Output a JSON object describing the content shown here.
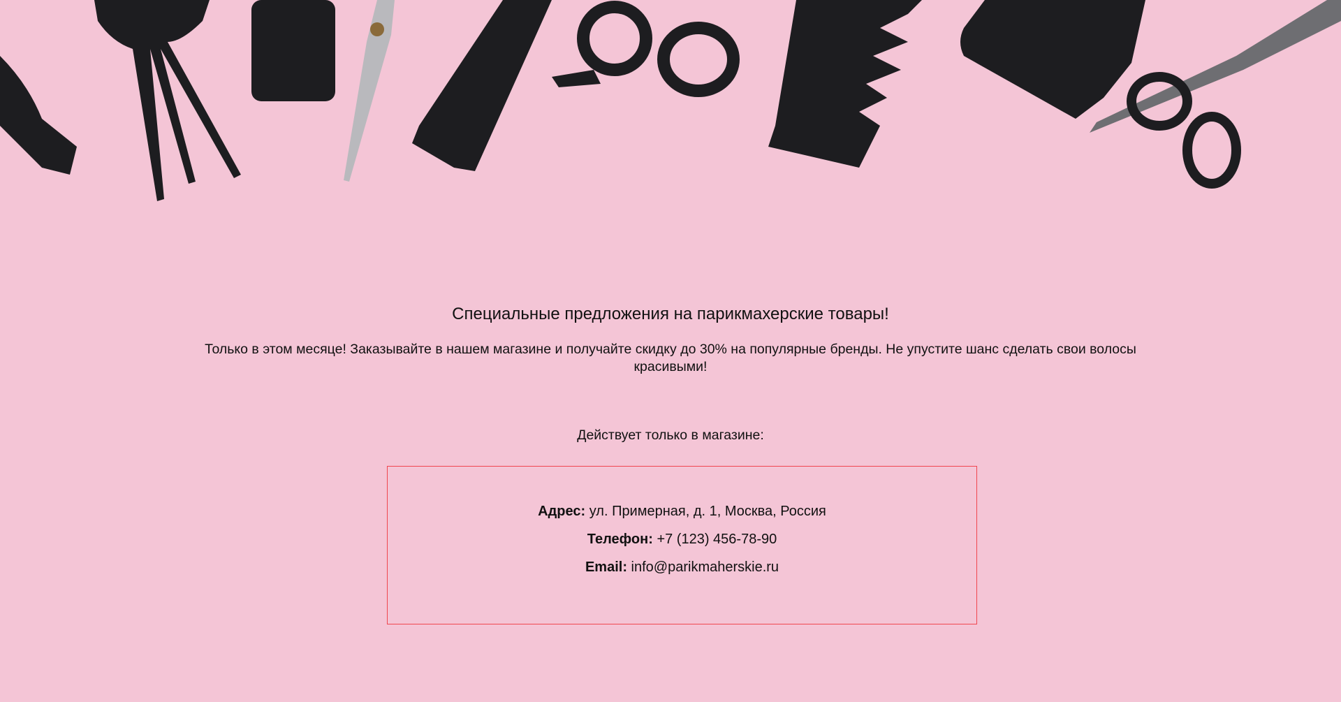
{
  "hero": {
    "image": "hairdresser-tools-banner",
    "icons": [
      "hair-dryer-icon",
      "fork-comb-icon",
      "comb-icon",
      "scissors-icon",
      "comb-icon",
      "scissors-icon",
      "wide-comb-icon",
      "clipper-icon",
      "thinning-scissors-icon"
    ]
  },
  "promo": {
    "title": "Специальные предложения на парикмахерские товары!",
    "description": "Только в этом месяце! Заказывайте в нашем магазине и получайте скидку до 30% на популярные бренды. Не упустите шанс сделать свои волосы красивыми!",
    "note": "Действует только в магазине:"
  },
  "contacts": {
    "address_label": "Адрес:",
    "address": "ул. Примерная, д. 1, Москва, Россия",
    "phone_label": "Телефон:",
    "phone": "+7 (123) 456-78-90",
    "email_label": "Email:",
    "email": "info@parikmaherskie.ru"
  },
  "colors": {
    "background": "#f4c5d6",
    "box_border": "#f0464f",
    "tools": "#1c1c1e"
  }
}
